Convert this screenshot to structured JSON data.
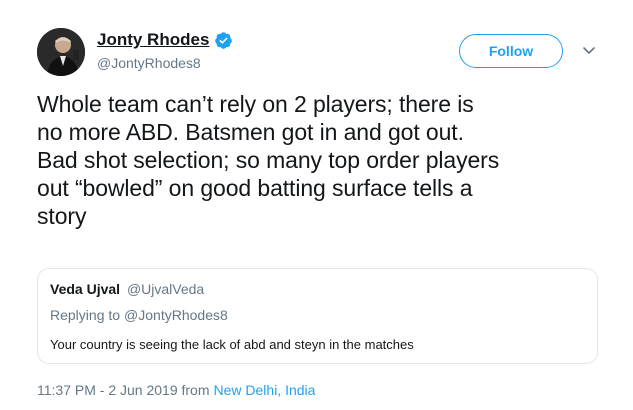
{
  "author": {
    "name": "Jonty Rhodes",
    "handle": "@JontyRhodes8",
    "verified": true
  },
  "follow_label": "Follow",
  "tweet_lines": [
    "Whole team can’t rely on 2 players; there is",
    "no more ABD. Batsmen got in and got out.",
    "Bad shot selection; so many top order players",
    "out “bowled” on good batting surface tells a",
    "story"
  ],
  "quoted": {
    "name": "Veda Ujval",
    "handle": "@UjvalVeda",
    "replying_prefix": "Replying to",
    "replying_handle": "@JontyRhodes8",
    "text": "Your country is seeing the lack of abd and steyn in the matches"
  },
  "meta": {
    "time": "11:37 PM - 2 Jun 2019",
    "from_word": "from",
    "location": "New Delhi, India"
  },
  "colors": {
    "accent": "#1da1f2",
    "secondary_text": "#657786",
    "border": "#e1e8ed"
  },
  "icons": [
    "avatar",
    "verified-badge-icon",
    "chevron-down-icon"
  ]
}
